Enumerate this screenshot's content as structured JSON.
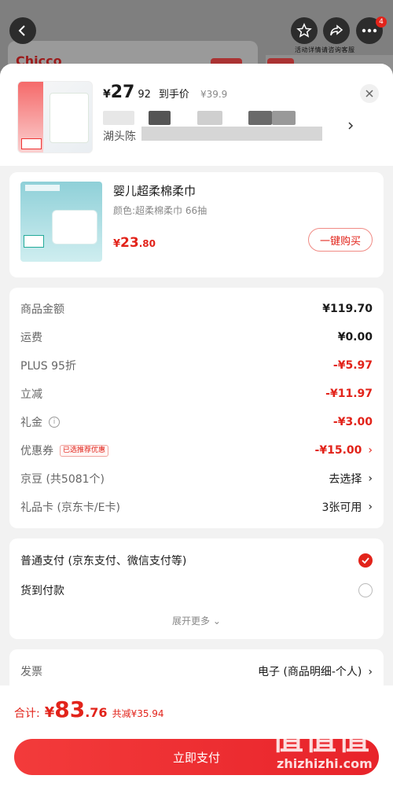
{
  "topbar": {
    "caption": "活动详情请咨询客服",
    "more_badge": "4",
    "bg_logo": "Chicco"
  },
  "summary": {
    "price_symbol": "¥",
    "price_int": "27",
    "price_dec": "92",
    "price_note": "到手价",
    "original_price": "¥39.9",
    "address_line": "湖头陈"
  },
  "product": {
    "title": "婴儿超柔棉柔巾",
    "spec": "颜色:超柔棉柔巾 66抽",
    "price_symbol": "¥",
    "price_int": "23",
    "price_dec": ".80",
    "buy_label": "一键购买"
  },
  "fees": [
    {
      "label": "商品金额",
      "value": "¥119.70"
    },
    {
      "label": "运费",
      "value": "¥0.00"
    },
    {
      "label": "PLUS 95折",
      "value": "-¥5.97"
    },
    {
      "label": "立减",
      "value": "-¥11.97"
    },
    {
      "label": "礼金",
      "value": "-¥3.00"
    },
    {
      "label": "优惠券",
      "badge": "已选推荐优惠",
      "value": "-¥15.00"
    },
    {
      "label": "京豆 (共5081个)",
      "value": "去选择"
    },
    {
      "label": "礼品卡 (京东卡/E卡)",
      "value": "3张可用"
    }
  ],
  "payment": {
    "option1": "普通支付 (京东支付、微信支付等)",
    "option2": "货到付款",
    "expand": "展开更多"
  },
  "invoice": {
    "label": "发票",
    "value": "电子 (商品明细-个人)"
  },
  "footer": {
    "total_label": "合计:",
    "total_symbol": "¥",
    "total_int": "83",
    "total_dec": ".76",
    "saved": "共减¥35.94",
    "pay_button": "立即支付"
  },
  "watermark": {
    "big": "值值值",
    "small": "zhizhizhi.com"
  },
  "colors": {
    "accent": "#e2231a",
    "sheet_bg": "#f2f2f2"
  }
}
